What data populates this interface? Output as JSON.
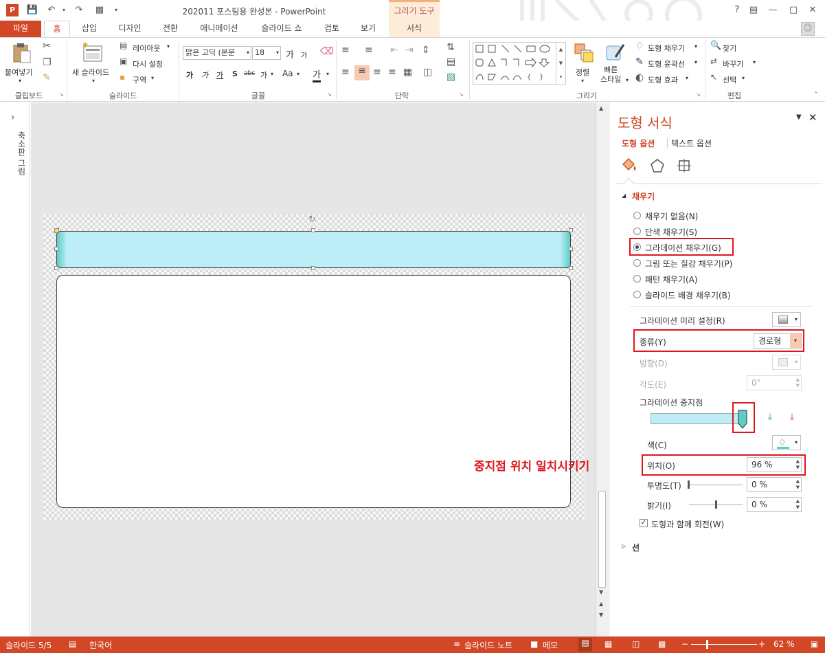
{
  "window": {
    "title": "202011 포스팅용 완성본 - PowerPoint",
    "context_tab_title": "그리기 도구",
    "help": "?",
    "controls": [
      "restore-ribbon",
      "minimize",
      "maximize",
      "close"
    ]
  },
  "tabs": {
    "file": "파일",
    "items": [
      "홈",
      "삽입",
      "디자인",
      "전환",
      "애니메이션",
      "슬라이드 쇼",
      "검토",
      "보기"
    ],
    "active": "홈",
    "context": "서식"
  },
  "ribbon": {
    "clipboard": {
      "label": "클립보드",
      "paste": "붙여넣기"
    },
    "slides": {
      "label": "슬라이드",
      "new_slide": "새 슬라이드",
      "layout": "레이아웃",
      "reset": "다시 설정",
      "section": "구역"
    },
    "font": {
      "label": "글꼴",
      "font_name": "맑은 고딕 (본문",
      "font_size": "18",
      "grow": "가",
      "shrink": "가",
      "bold": "가",
      "italic": "가",
      "underline": "가",
      "shadow": "S",
      "strike": "abc",
      "spacing": "가",
      "case": "Aa",
      "color": "가"
    },
    "paragraph": {
      "label": "단락"
    },
    "drawing": {
      "label": "그리기",
      "arrange": "정렬",
      "quick_styles": "빠른\n스타일",
      "shape_fill": "도형 채우기",
      "shape_outline": "도형 윤곽선",
      "shape_effects": "도형 효과"
    },
    "editing": {
      "label": "편집",
      "find": "찾기",
      "replace": "바꾸기",
      "select": "선택"
    }
  },
  "thumb_strip": {
    "label": "축소판 그림",
    "expand": "›"
  },
  "format_pane": {
    "title": "도형 서식",
    "tab_shape_options": "도형 옵션",
    "tab_text_options": "텍스트 옵션",
    "section_fill": "채우기",
    "fill_options": [
      {
        "label": "채우기 없음(N)",
        "selected": false
      },
      {
        "label": "단색 채우기(S)",
        "selected": false
      },
      {
        "label": "그라데이션 채우기(G)",
        "selected": true
      },
      {
        "label": "그림 또는 질감 채우기(P)",
        "selected": false
      },
      {
        "label": "패턴 채우기(A)",
        "selected": false
      },
      {
        "label": "슬라이드 배경 채우기(B)",
        "selected": false
      }
    ],
    "preset_label": "그라데이션 미리 설정(R)",
    "type_label": "종류(Y)",
    "type_value": "경로형",
    "direction_label": "방향(D)",
    "angle_label": "각도(E)",
    "angle_value": "0°",
    "stops_label": "그라데이션 중지점",
    "color_label": "색(C)",
    "position_label": "위치(O)",
    "position_value": "96 %",
    "transparency_label": "투명도(T)",
    "transparency_value": "0 %",
    "brightness_label": "밝기(I)",
    "brightness_value": "0 %",
    "rotate_with_shape_label": "도형과 함께 회전(W)",
    "rotate_with_shape": true,
    "section_line": "선",
    "annotation": "중지점 위치 일치시키기"
  },
  "status": {
    "slide": "슬라이드 5/5",
    "language": "한국어",
    "notes": "슬라이드 노트",
    "comments": "메모",
    "zoom": "62 %"
  },
  "colors": {
    "accent": "#d24726",
    "shape_fill_light": "#bdeef8",
    "shape_fill_dark": "#5ecdc7",
    "annotation_red": "#e0161d"
  }
}
